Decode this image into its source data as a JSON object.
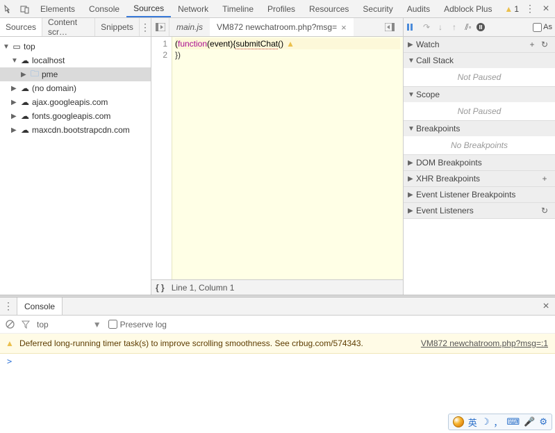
{
  "toolbar": {
    "tabs": [
      "Elements",
      "Console",
      "Sources",
      "Network",
      "Timeline",
      "Profiles",
      "Resources",
      "Security",
      "Audits",
      "Adblock Plus"
    ],
    "active": "Sources",
    "warning_count": "1"
  },
  "left_tabs": {
    "items": [
      "Sources",
      "Content scr…",
      "Snippets"
    ],
    "active": "Sources"
  },
  "file_tabs": [
    {
      "label": "main.js",
      "active": false
    },
    {
      "label": "VM872 newchatroom.php?msg=",
      "active": true
    }
  ],
  "right_bar": {
    "async_label": "As"
  },
  "tree": {
    "top": "top",
    "host": "localhost",
    "folder": "pme",
    "items": [
      "(no domain)",
      "ajax.googleapis.com",
      "fonts.googleapis.com",
      "maxcdn.bootstrapcdn.com"
    ]
  },
  "code": {
    "line1": {
      "a": "(",
      "kw": "function",
      "b": "(event){",
      "fn": "submitChat",
      "c": "()"
    },
    "line2": "})",
    "gutter": [
      "1",
      "2"
    ]
  },
  "status": {
    "pos": "Line 1, Column 1"
  },
  "debug": {
    "watch": "Watch",
    "callstack": "Call Stack",
    "callstack_body": "Not Paused",
    "scope": "Scope",
    "scope_body": "Not Paused",
    "breakpoints": "Breakpoints",
    "breakpoints_body": "No Breakpoints",
    "dom_bp": "DOM Breakpoints",
    "xhr_bp": "XHR Breakpoints",
    "ev_bp": "Event Listener Breakpoints",
    "ev_l": "Event Listeners"
  },
  "drawer": {
    "tab": "Console",
    "context": "top",
    "preserve": "Preserve log",
    "msg": "Deferred long-running timer task(s) to improve scrolling smoothness. See crbug.com/574343.",
    "link": "VM872 newchatroom.php?msg=:1",
    "prompt": ">"
  },
  "ime": {
    "lang": "英",
    "moon": "☽",
    "comma": "，",
    "kb": "⌨",
    "mic": "🎤",
    "gear": "⚙"
  }
}
